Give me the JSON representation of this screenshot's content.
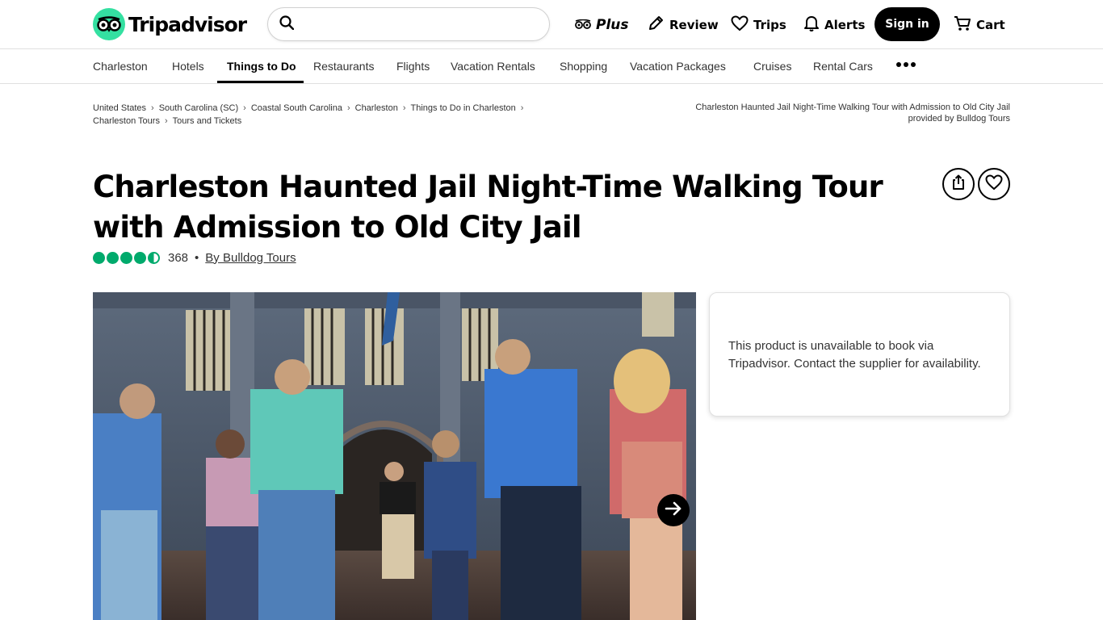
{
  "header": {
    "logo_text": "Tripadvisor",
    "search_placeholder": "",
    "plus_label": "Plus",
    "review_label": "Review",
    "trips_label": "Trips",
    "alerts_label": "Alerts",
    "signin_label": "Sign in",
    "cart_label": "Cart"
  },
  "nav": {
    "items": [
      "Charleston",
      "Hotels",
      "Things to Do",
      "Restaurants",
      "Flights",
      "Vacation Rentals",
      "Shopping",
      "Vacation Packages",
      "Cruises",
      "Rental Cars"
    ],
    "active": "Things to Do"
  },
  "breadcrumbs": {
    "items": [
      "United States",
      "South Carolina (SC)",
      "Coastal South Carolina",
      "Charleston",
      "Things to Do in Charleston",
      "Charleston Tours",
      "Tours and Tickets"
    ],
    "right_title": "Charleston Haunted Jail Night-Time Walking Tour with Admission to Old City Jail",
    "right_provider": "provided by Bulldog Tours"
  },
  "product": {
    "title": "Charleston Haunted Jail Night-Time Walking Tour with Admission to Old City Jail",
    "rating": 4.5,
    "review_count": "368",
    "separator": "•",
    "by_label": "By Bulldog Tours"
  },
  "booking": {
    "message": "This product is unavailable to book via Tripadvisor. Contact the supplier for availability."
  },
  "colors": {
    "brand_green": "#34e0a1",
    "rating_green": "#00aa6c",
    "text_dark": "#000000"
  }
}
